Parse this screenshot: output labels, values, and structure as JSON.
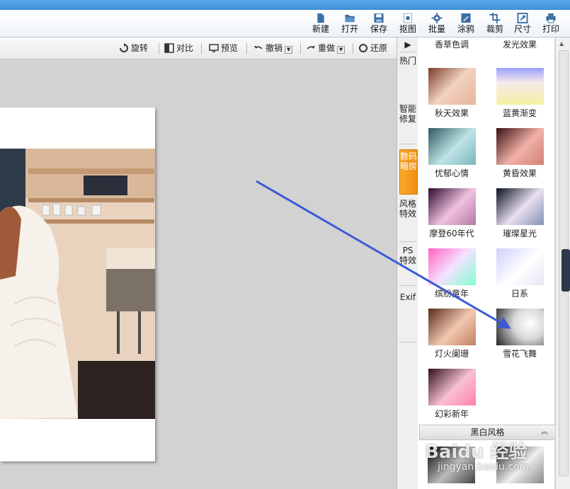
{
  "toolbar": {
    "buttons": [
      {
        "label": "新建",
        "icon": "new-file-icon"
      },
      {
        "label": "打开",
        "icon": "open-folder-icon"
      },
      {
        "label": "保存",
        "icon": "save-icon"
      },
      {
        "label": "抠图",
        "icon": "cutout-icon"
      },
      {
        "label": "批量",
        "icon": "batch-gear-icon"
      },
      {
        "label": "涂鸦",
        "icon": "doodle-icon"
      },
      {
        "label": "裁剪",
        "icon": "crop-icon"
      },
      {
        "label": "尺寸",
        "icon": "resize-icon"
      },
      {
        "label": "打印",
        "icon": "print-icon"
      }
    ]
  },
  "subbar": {
    "rotate": "旋转",
    "compare": "对比",
    "preview": "预览",
    "undo": "撤销",
    "redo": "重做",
    "restore": "还原"
  },
  "side_tabs": [
    {
      "label": "热门",
      "active": false
    },
    {
      "label": "智能修复",
      "active": false
    },
    {
      "label": "数码暗房",
      "active": true
    },
    {
      "label": "风格特效",
      "active": false
    },
    {
      "label": "PS特效",
      "active": false
    },
    {
      "label": "Exif",
      "active": false
    }
  ],
  "effects": [
    {
      "name": "香草色调"
    },
    {
      "name": "发光效果"
    },
    {
      "name": "秋天效果"
    },
    {
      "name": "蓝黄渐变"
    },
    {
      "name": "忧郁心情"
    },
    {
      "name": "黄昏效果"
    },
    {
      "name": "摩登60年代"
    },
    {
      "name": "璀璨星光"
    },
    {
      "name": "缤纷童年"
    },
    {
      "name": "日系"
    },
    {
      "name": "灯火阑珊"
    },
    {
      "name": "雪花飞舞"
    },
    {
      "name": "幻彩新年"
    }
  ],
  "section": {
    "title": "黑白风格"
  },
  "watermark": {
    "text": "Baidu 经验",
    "url_text": "jingyan.baidu.com"
  },
  "colors": {
    "accent_tab": "#f08d10",
    "arrow": "#3b5bd6",
    "titlebar": "#3d8fd6"
  }
}
